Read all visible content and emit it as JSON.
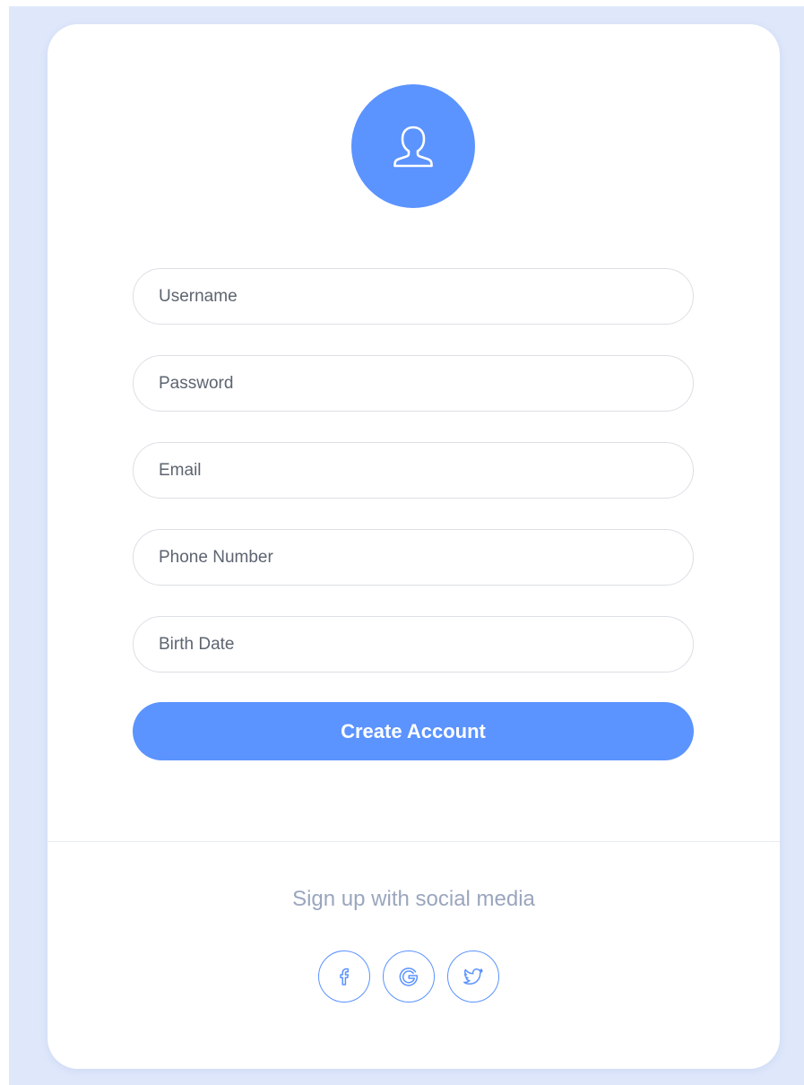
{
  "colors": {
    "accent": "#5b93ff",
    "background": "#dfe8fb",
    "card": "#ffffff",
    "social_text": "#9aa6bd"
  },
  "avatar": {
    "icon": "user-icon"
  },
  "form": {
    "username_placeholder": "Username",
    "password_placeholder": "Password",
    "email_placeholder": "Email",
    "phone_placeholder": "Phone Number",
    "birthdate_placeholder": "Birth Date",
    "submit_label": "Create Account"
  },
  "social": {
    "title": "Sign up with social media",
    "buttons": [
      {
        "icon": "facebook-icon"
      },
      {
        "icon": "google-icon"
      },
      {
        "icon": "twitter-icon"
      }
    ]
  }
}
